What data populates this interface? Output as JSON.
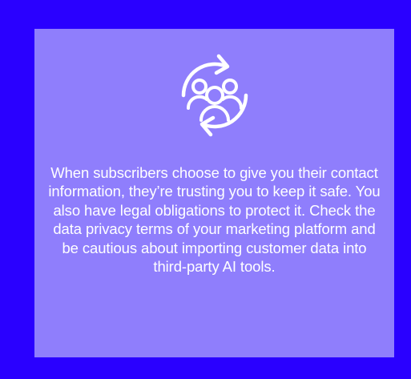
{
  "colors": {
    "frame_border": "#2a00ff",
    "card_background": "#8f7efc",
    "text": "#ffffff",
    "icon_stroke": "#ffffff"
  },
  "icon": {
    "name": "people-cycle-icon"
  },
  "message": "When subscribers choose to give you their contact information, they’re trusting you to keep it safe. You also have legal obligations to protect it. Check the data privacy terms of your marketing platform and be cautious about importing customer data into third-party AI tools."
}
